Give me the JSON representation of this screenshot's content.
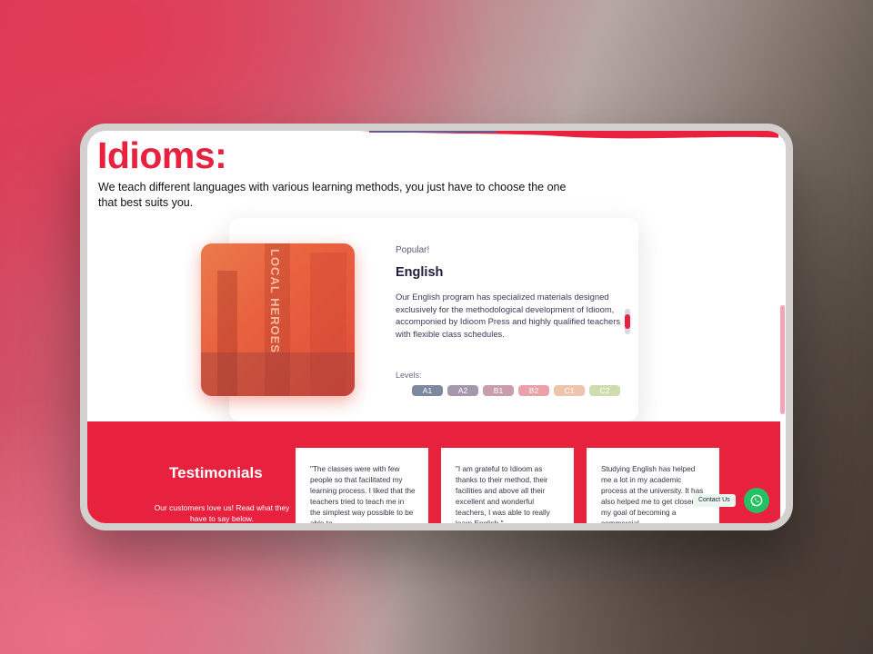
{
  "header": {
    "title": "Idioms:",
    "subtitle": "We teach different languages with various learning methods, you just have to choose the one that best suits you."
  },
  "course": {
    "tag": "Popular!",
    "name": "English",
    "image_sign": "LOCAL HEROES",
    "description": "Our English program has specialized materials designed exclusively for the methodological development of Idioom, accomponied by Idioom Press and highly qualified teachers with flexible class schedules.",
    "levels_label": "Levels:",
    "levels": [
      {
        "label": "A1",
        "color": "#7c889e"
      },
      {
        "label": "A2",
        "color": "#a597ae"
      },
      {
        "label": "B1",
        "color": "#c99eab"
      },
      {
        "label": "B2",
        "color": "#eaa1a9"
      },
      {
        "label": "C1",
        "color": "#eec4ad"
      },
      {
        "label": "C2",
        "color": "#cfdcad"
      }
    ]
  },
  "testimonials": {
    "title": "Testimonials",
    "subtitle": "Our customers love us! Read what they have to say below.",
    "items": [
      {
        "text": "\"The classes were with few people so that facilitated my learning process. I liked that the teachers tried to teach me in the simplest way possible to be able to"
      },
      {
        "text": "\"I am grateful to Idioom as thanks to their method, their facilities and above all their excellent and wonderful teachers, I was able to really learn English.\""
      },
      {
        "text": "Studying English has helped me a lot in my academic process at the university. It has also helped me to get closer to my goal of becoming a commercial"
      }
    ]
  },
  "contact": {
    "label": "Contact Us",
    "icon": "whatsapp-icon"
  },
  "colors": {
    "accent": "#e8213e",
    "whatsapp": "#25c063"
  }
}
